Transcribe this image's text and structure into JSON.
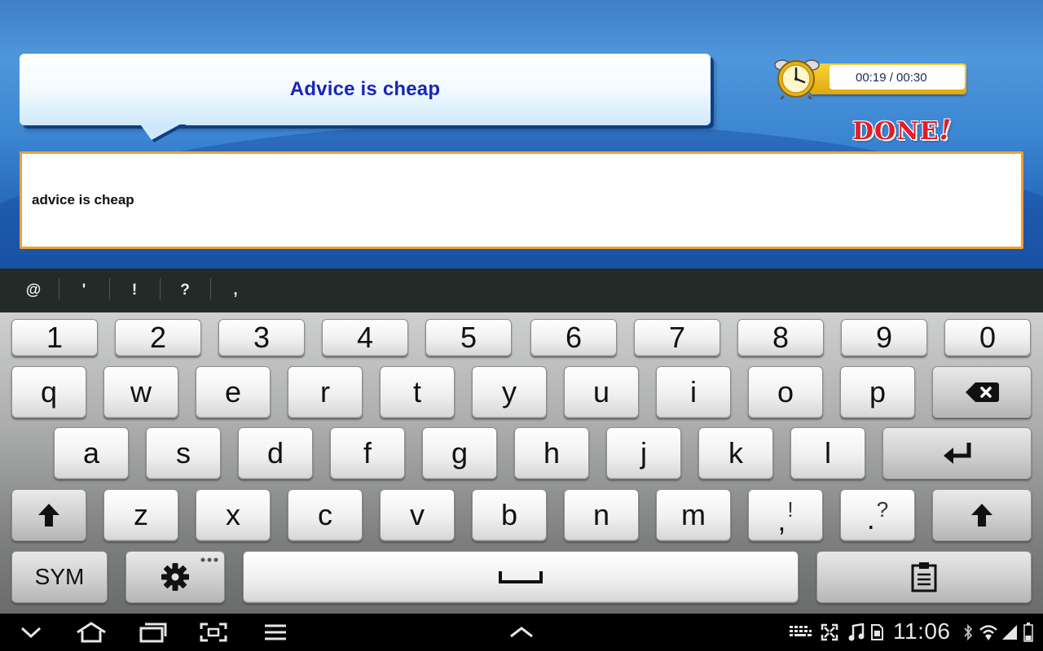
{
  "app": {
    "prompt": "Advice is cheap",
    "timer": "00:19 / 00:30",
    "done_label": "DONE",
    "done_exclaim": "!",
    "answer_text": "advice is cheap"
  },
  "suggestions": [
    "@",
    "'",
    "!",
    "?",
    ","
  ],
  "keyboard": {
    "row_numbers": [
      "1",
      "2",
      "3",
      "4",
      "5",
      "6",
      "7",
      "8",
      "9",
      "0"
    ],
    "row1": [
      "q",
      "w",
      "e",
      "r",
      "t",
      "y",
      "u",
      "i",
      "o",
      "p"
    ],
    "row2": [
      "a",
      "s",
      "d",
      "f",
      "g",
      "h",
      "j",
      "k",
      "l"
    ],
    "row3": [
      "z",
      "x",
      "c",
      "v",
      "b",
      "n",
      "m"
    ],
    "comma_main": ",",
    "comma_alt": "!",
    "period_main": ".",
    "period_alt": "?",
    "sym_label": "SYM",
    "icons": {
      "backspace": "backspace-icon",
      "enter": "enter-icon",
      "shift": "shift-icon",
      "settings": "gear-icon",
      "space": "space-icon",
      "clipboard": "clipboard-icon"
    }
  },
  "navbar": {
    "time": "11:06",
    "icons": [
      "back-icon",
      "home-icon",
      "recent-apps-icon",
      "screenshot-icon",
      "menu-icon",
      "keyboard-hide-icon",
      "keyboard-status-icon",
      "fullscreen-icon",
      "music-icon",
      "sim-icon",
      "bluetooth-icon",
      "wifi-icon",
      "signal-icon",
      "battery-icon"
    ]
  },
  "colors": {
    "prompt_text": "#1a24b8",
    "done_red": "#e51c23",
    "answer_border": "#f0a030",
    "app_blue": "#3c86d2"
  }
}
